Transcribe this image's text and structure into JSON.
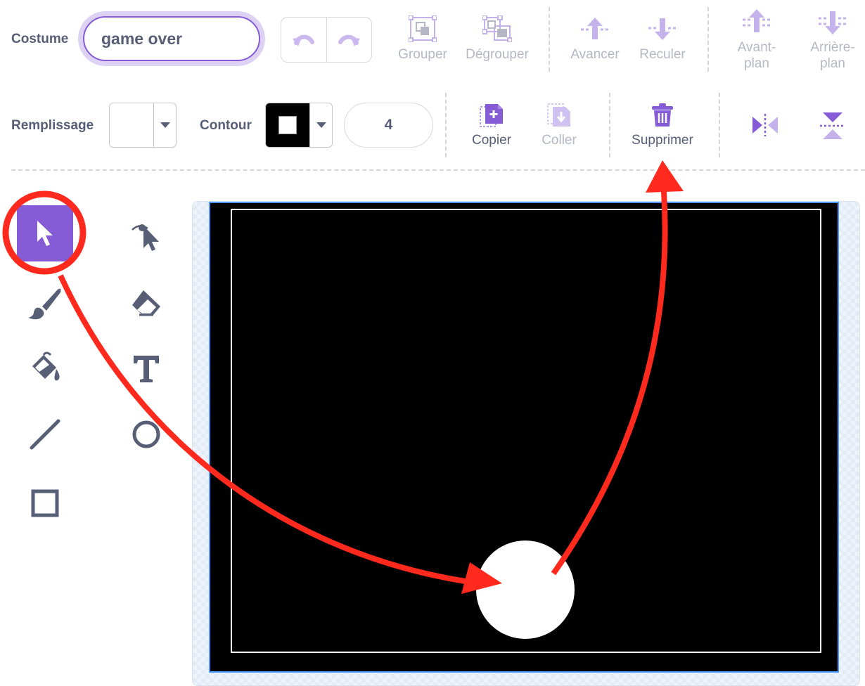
{
  "toolbar": {
    "costume_label": "Costume",
    "costume_name": "game over",
    "group_label": "Grouper",
    "ungroup_label": "Dégrouper",
    "forward_label": "Avancer",
    "backward_label": "Reculer",
    "front_label": "Avant-\nplan",
    "back_label": "Arrière-\nplan"
  },
  "style_bar": {
    "fill_label": "Remplissage",
    "outline_label": "Contour",
    "outline_width": "4",
    "copy_label": "Copier",
    "paste_label": "Coller",
    "delete_label": "Supprimer"
  },
  "tools": [
    "select",
    "reshape",
    "brush",
    "eraser",
    "fill",
    "text",
    "line",
    "circle",
    "rectangle"
  ],
  "colors": {
    "accent": "#855cd6",
    "text": "#575e75",
    "disabled": "#b5b8c4",
    "annotation": "#ff2a1d",
    "stage_bg": "#000000"
  }
}
